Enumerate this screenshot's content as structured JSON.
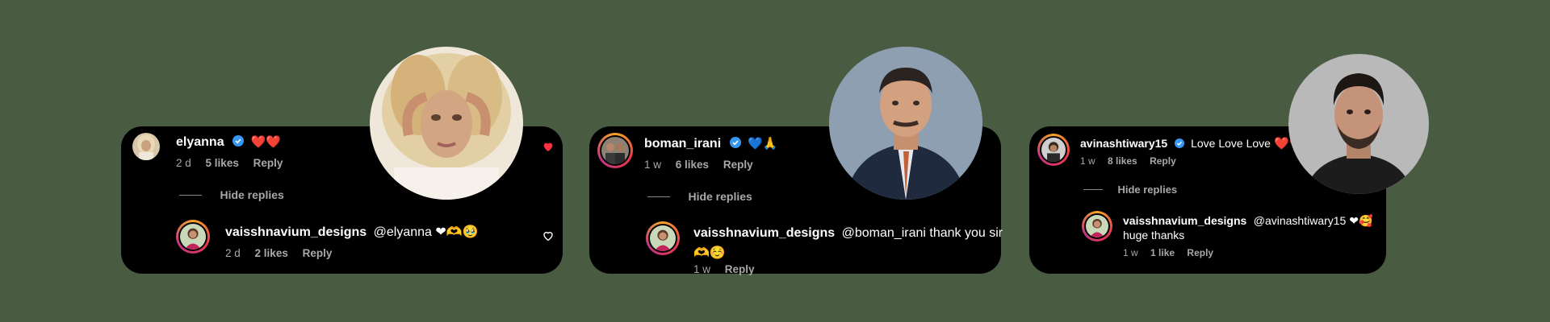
{
  "cards": [
    {
      "comment": {
        "username": "elyanna",
        "text": "",
        "emojis": "❤️❤️",
        "time": "2 d",
        "likes": "5 likes",
        "reply": "Reply"
      },
      "hide_replies": "Hide replies",
      "reply": {
        "username": "vaisshnavium_designs",
        "text": "@elyanna ❤🫶🥹",
        "time": "2 d",
        "likes": "2 likes",
        "reply": "Reply"
      }
    },
    {
      "comment": {
        "username": "boman_irani",
        "text": "",
        "emojis": "💙🙏",
        "time": "1 w",
        "likes": "6 likes",
        "reply": "Reply"
      },
      "hide_replies": "Hide replies",
      "reply": {
        "username": "vaisshnavium_designs",
        "text": "@boman_irani thank you sir",
        "text2": "🫶☺️",
        "time": "1 w",
        "reply": "Reply"
      }
    },
    {
      "comment": {
        "username": "avinashtiwary15",
        "text": "Love Love Love",
        "emojis": "❤️❤️",
        "time": "1 w",
        "likes": "8 likes",
        "reply": "Reply"
      },
      "hide_replies": "Hide replies",
      "reply": {
        "username": "vaisshnavium_designs",
        "text": "@avinashtiwary15 ❤🥰",
        "text2": "huge thanks",
        "time": "1 w",
        "likes": "1 like",
        "reply": "Reply"
      }
    }
  ],
  "colors": {
    "background": "#495c42",
    "card": "#000000",
    "muted": "#a8a8a8",
    "verified": "#3897f0",
    "like_active": "#ff3040"
  }
}
